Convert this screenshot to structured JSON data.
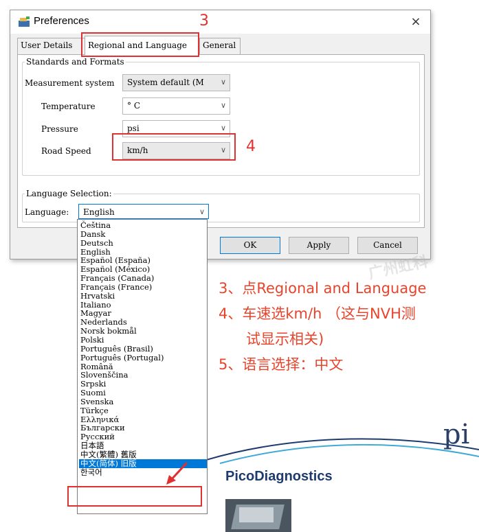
{
  "window": {
    "title": "Preferences",
    "close_glyph": "×"
  },
  "tabs": [
    {
      "label": "User Details"
    },
    {
      "label": "Regional and Language"
    },
    {
      "label": "General"
    }
  ],
  "standards": {
    "group_label": "Standards and Formats",
    "measurement": {
      "label": "Measurement system",
      "value": "System default (M"
    },
    "temperature": {
      "label": "Temperature",
      "value": "° C"
    },
    "pressure": {
      "label": "Pressure",
      "value": "psi"
    },
    "road_speed": {
      "label": "Road Speed",
      "value": "km/h"
    }
  },
  "language": {
    "group_label": "Language Selection:",
    "label": "Language:",
    "value": "English",
    "options": [
      "Čeština",
      "Dansk",
      "Deutsch",
      "English",
      "Español (España)",
      "Español (México)",
      "Français (Canada)",
      "Français (France)",
      "Hrvatski",
      "Italiano",
      "Magyar",
      "Nederlands",
      "Norsk bokmål",
      "Polski",
      "Português (Brasil)",
      "Português (Portugal)",
      "Română",
      "Slovenščina",
      "Srpski",
      "Suomi",
      "Svenska",
      "Türkçe",
      "Ελληνικά",
      "Български",
      "Русский",
      "日本語",
      "中文(繁體) 舊版",
      "中文(简体) 旧版",
      "한국어"
    ],
    "selected_index": 27
  },
  "buttons": {
    "ok": "OK",
    "apply": "Apply",
    "cancel": "Cancel"
  },
  "annotations": {
    "step3": "3",
    "step4": "4",
    "step5": "5",
    "note1": "3、点Regional and Language",
    "note2": "4、车速选km/h （这与NVH测",
    "note2b": "试显示相关)",
    "note3": "5、语言选择：中文",
    "watermark": "广州虹科"
  },
  "branding": {
    "name": "PicoDiagnostics",
    "partial_logo": "pi"
  },
  "colors": {
    "annotation_red": "#e03030",
    "selection_blue": "#0078d7",
    "brand_navy": "#1e3b6e"
  }
}
